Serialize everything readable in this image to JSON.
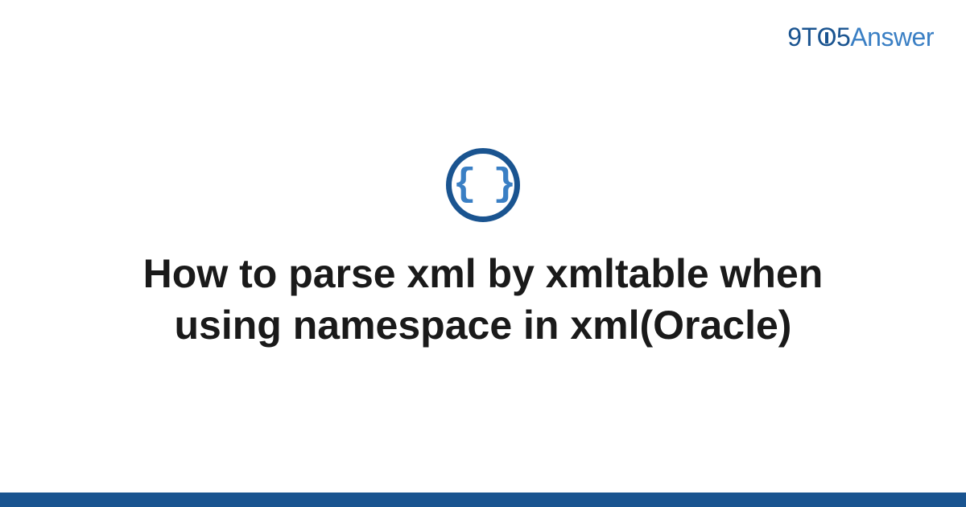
{
  "logo": {
    "prefix": "9T",
    "middle_o": "O",
    "five": "5",
    "suffix": "Answer"
  },
  "category": {
    "symbol": "{ }"
  },
  "title": "How to parse xml by xmltable when using namespace in xml(Oracle)"
}
